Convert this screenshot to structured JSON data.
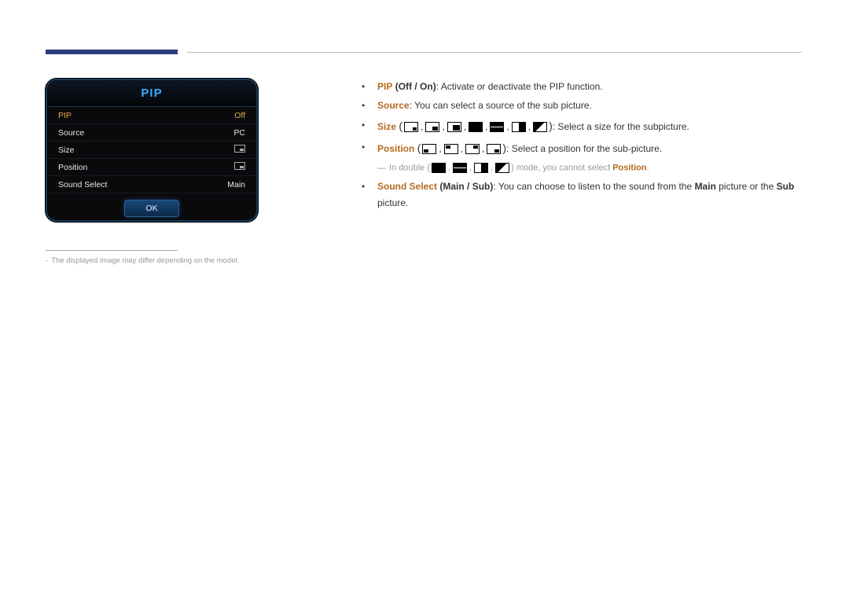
{
  "decor": {
    "footnote_dash": "-",
    "bullet_dot": "•"
  },
  "osd": {
    "title": "PIP",
    "rows": [
      {
        "label": "PIP",
        "value": "Off",
        "selected": true,
        "icon": null
      },
      {
        "label": "Source",
        "value": "PC",
        "selected": false,
        "icon": null
      },
      {
        "label": "Size",
        "value": "",
        "selected": false,
        "icon": "pip-icon"
      },
      {
        "label": "Position",
        "value": "",
        "selected": false,
        "icon": "pip-icon"
      },
      {
        "label": "Sound Select",
        "value": "Main",
        "selected": false,
        "icon": null
      }
    ],
    "ok": "OK"
  },
  "footnote": "The displayed image may differ depending on the model.",
  "content": {
    "pip": {
      "label": "PIP",
      "lparen": "(",
      "off": "Off",
      "slash": " / ",
      "on": "On",
      "rparen": ")",
      "desc": ": Activate or deactivate the PIP function."
    },
    "source": {
      "label": "Source",
      "desc": ": You can select a source of the sub picture."
    },
    "size": {
      "label": "Size",
      "desc": ": Select a size for the subpicture."
    },
    "position": {
      "label": "Position",
      "desc": ": Select a position for the sub-picture."
    },
    "subnote": {
      "prefix": "In double (",
      "suffix": ") mode, you cannot select ",
      "posword": "Position",
      "end": "."
    },
    "sound": {
      "label": "Sound Select",
      "lparen": "(",
      "main": "Main",
      "slash": " / ",
      "sub": "Sub",
      "rparen": ")",
      "desc_a": ": You can choose to listen to the sound from the ",
      "desc_b": " picture or the ",
      "desc_c": " picture."
    }
  }
}
